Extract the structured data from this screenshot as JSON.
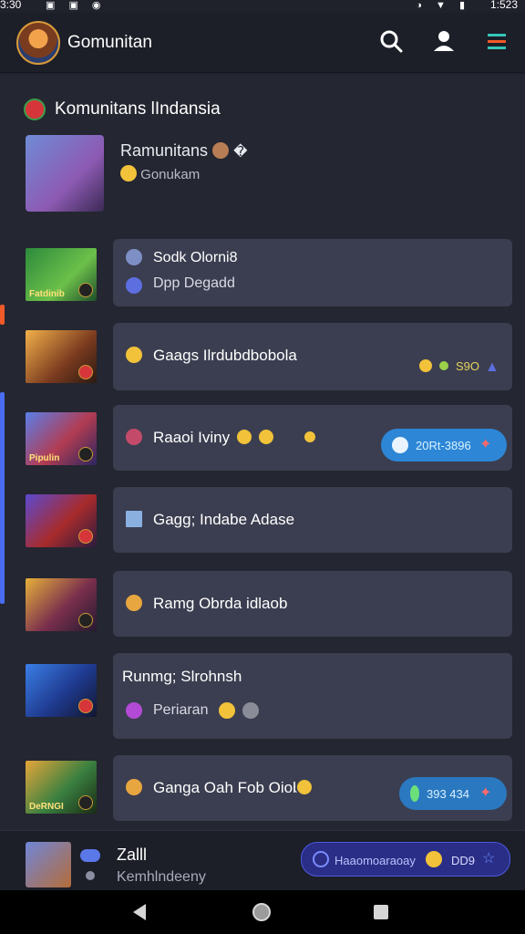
{
  "status_bar": {
    "time_left": "3:30",
    "time_right": "1:523",
    "left_icons": "▣ ▣ ◉",
    "right_icons": "◑ ▼ ▮"
  },
  "app_bar": {
    "title": "Gomunitan",
    "icons": [
      "search-icon",
      "user-icon",
      "menu-icon"
    ],
    "menu_color": "#34c7b8"
  },
  "section": {
    "title": "Komunitans lIndansia"
  },
  "featured": {
    "name": "Ramunitans",
    "name_badge": "�",
    "subtitle": "Gonukam"
  },
  "rows": [
    {
      "thumb_label": "Fatdinib",
      "line1": "Sodk Olorni8",
      "line2": "Dpp Degadd"
    },
    {
      "thumb_label": "",
      "line1": "Gaags Ilrdubdbobola",
      "right_text": "S9O"
    },
    {
      "thumb_label": "Pipulin",
      "line1": "Raaoi Iviny",
      "pill_text": "20Rt-3896"
    },
    {
      "thumb_label": "",
      "line1": "Gagg; Indabe Adase"
    },
    {
      "thumb_label": "",
      "line1": "Ramg Obrda idlaob"
    },
    {
      "thumb_label": "",
      "line1": "Runmg; Slrohnsh",
      "line2": "Periaran"
    },
    {
      "thumb_label": "DeRNGI",
      "line1": "Ganga Oah Fob Oiob",
      "pill_text": "393  434"
    }
  ],
  "bottom_item": {
    "name": "Zalll",
    "subtitle": "Kemhlndeeny",
    "pill_text": "Haaomoaraoay",
    "pill_num": "DD9"
  },
  "colors": {
    "bg": "#242631",
    "card": "#3b3e50",
    "pill_blue": "#2d86d6",
    "pill_teal": "#2a78c0",
    "pill_purple": "#2b2e86",
    "side_orange": "#f05a28",
    "side_blue": "#4a6cf0"
  }
}
